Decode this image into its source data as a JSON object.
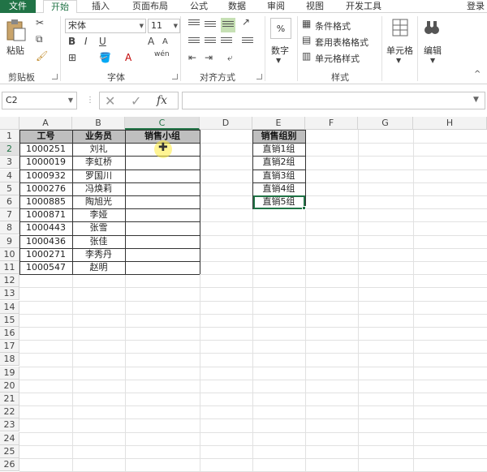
{
  "tabs": [
    "文件",
    "开始",
    "插入",
    "页面布局",
    "公式",
    "数据",
    "审阅",
    "视图",
    "开发工具"
  ],
  "login_label": "登录",
  "ribbon": {
    "clipboard": {
      "label": "剪贴板",
      "paste_label": "粘贴"
    },
    "font": {
      "label": "字体",
      "font_name": "宋体",
      "font_size": "11",
      "bold": "B",
      "italic": "I",
      "underline": "U",
      "grow": "A",
      "shrink": "A",
      "wen": "wén"
    },
    "alignment": {
      "label": "对齐方式"
    },
    "number": {
      "label": "数字",
      "button_label": "数字",
      "percent": "%"
    },
    "styles": {
      "label": "样式",
      "conditional": "条件格式",
      "table_format": "套用表格格式",
      "cell_styles": "单元格样式"
    },
    "cells": {
      "label": "单元格"
    },
    "editing": {
      "label": "编辑"
    }
  },
  "formula_bar": {
    "name_box": "C2",
    "formula": "",
    "fx": "fx"
  },
  "columns": [
    "A",
    "B",
    "C",
    "D",
    "E",
    "F",
    "G",
    "H"
  ],
  "rows": [
    "1",
    "2",
    "3",
    "4",
    "5",
    "6",
    "7",
    "8",
    "9",
    "10",
    "11",
    "12",
    "13",
    "14",
    "15",
    "16",
    "17",
    "18",
    "19",
    "20",
    "21",
    "22",
    "23",
    "24",
    "25",
    "26"
  ],
  "table_headers": {
    "a": "工号",
    "b": "业务员",
    "c": "销售小组"
  },
  "employees": [
    {
      "id": "1000251",
      "name": "刘礼"
    },
    {
      "id": "1000019",
      "name": "李虹桥"
    },
    {
      "id": "1000932",
      "name": "罗国川"
    },
    {
      "id": "1000276",
      "name": "冯焕莉"
    },
    {
      "id": "1000885",
      "name": "陶旭光"
    },
    {
      "id": "1000871",
      "name": "李娅"
    },
    {
      "id": "1000443",
      "name": "张雪"
    },
    {
      "id": "1000436",
      "name": "张佳"
    },
    {
      "id": "1000271",
      "name": "李秀丹"
    },
    {
      "id": "1000547",
      "name": "赵明"
    }
  ],
  "group_header": "销售组别",
  "groups": [
    "直销1组",
    "直销2组",
    "直销3组",
    "直销4组",
    "直销5组"
  ],
  "colors": {
    "accent": "#217346",
    "header_fill": "#bfbfbf"
  }
}
